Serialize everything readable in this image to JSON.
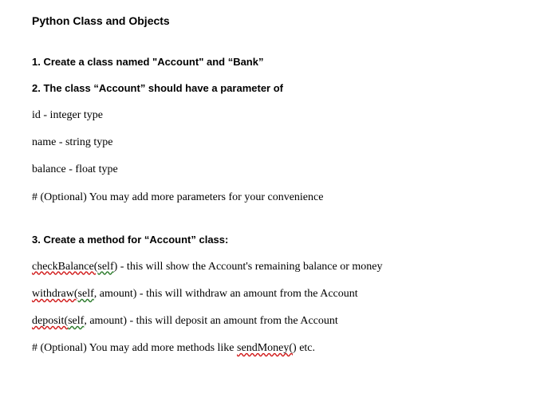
{
  "title": "Python Class and Objects",
  "item1": "1. Create a class named \"Account\" and “Bank”",
  "item2": "2. The class “Account” should have a parameter of",
  "params": {
    "id": "id   - integer type",
    "name": "name - string type",
    "balance": "balance - float type",
    "optional": "# (Optional) You may add more parameters for your convenience"
  },
  "item3": "3. Create a method for “Account” class:",
  "methods": {
    "check_pre": "checkBalance(",
    "check_self": "self",
    "check_post": ")    - this will show the Account's remaining balance or money",
    "withdraw_pre": "withdraw(",
    "withdraw_self": "self",
    "withdraw_post": ", amount)   - this will withdraw an amount from the Account",
    "deposit_pre": "deposit(",
    "deposit_self": "self",
    "deposit_post": ", amount) - this will deposit an amount from the Account",
    "optional_pre": "# (Optional) You may add more methods like ",
    "optional_method": "sendMoney(",
    "optional_post": ") etc."
  }
}
